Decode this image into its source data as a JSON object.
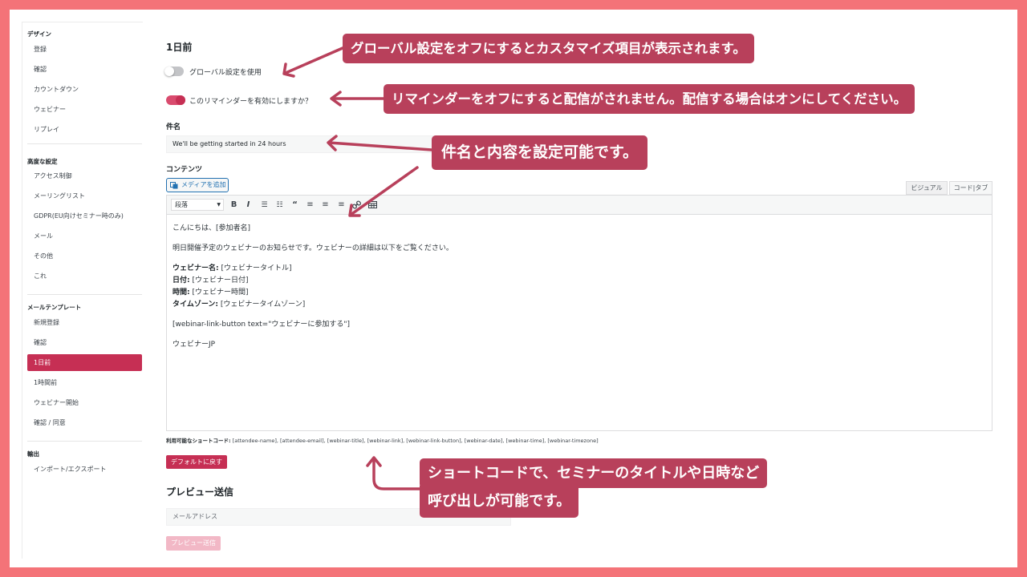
{
  "sidebar": {
    "sections": [
      {
        "heading": "デザイン",
        "items": [
          "登録",
          "確認",
          "カウントダウン",
          "ウェビナー",
          "リプレイ"
        ]
      },
      {
        "heading": "高度な設定",
        "items": [
          "アクセス制御",
          "メーリングリスト",
          "GDPR(EU向けセミナー時のみ)",
          "メール",
          "その他",
          "これ"
        ]
      },
      {
        "heading": "メールテンプレート",
        "items": [
          "新規登録",
          "確認",
          "1日前",
          "1時間前",
          "ウェビナー開始",
          "確認 / 同意"
        ]
      },
      {
        "heading": "輸出",
        "items": [
          "インポート/エクスポート"
        ]
      }
    ],
    "active_item": "1日前"
  },
  "main": {
    "title": "1日前",
    "global_toggle_label": "グローバル設定を使用",
    "global_toggle_on": false,
    "reminder_toggle_label": "このリマインダーを有効にしますか？",
    "reminder_toggle_on": true,
    "subject_label": "件名",
    "subject_value": "We'll be getting started in 24 hours",
    "content_label": "コンテンツ",
    "media_button": "メディアを追加",
    "tabs": [
      "ビジュアル",
      "コード|タブ"
    ],
    "format_select": "段落",
    "toolbar_icons": [
      "bold-icon",
      "italic-icon",
      "bullet-list-icon",
      "numbered-list-icon",
      "blockquote-icon",
      "align-left-icon",
      "align-center-icon",
      "align-right-icon",
      "link-icon",
      "table-icon"
    ],
    "editor": {
      "greeting": "こんにちは、[参加者名]",
      "intro": "明日開催予定のウェビナーのお知らせです。ウェビナーの詳細は以下をご覧ください。",
      "details": [
        {
          "key": "ウェビナー名:",
          "value": " [ウェビナータイトル]"
        },
        {
          "key": "日付:",
          "value": " [ウェビナー日付]"
        },
        {
          "key": "時間:",
          "value": " [ウェビナー時間]"
        },
        {
          "key": "タイムゾーン:",
          "value": " [ウェビナータイムゾーン]"
        }
      ],
      "shortcode": "[webinar-link-button text=\"ウェビナーに参加する\"]",
      "signature": "ウェビナーJP"
    },
    "shortcodes_label": "利用可能なショートコード:",
    "shortcodes_list": " [attendee-name], [attendee-email], [webinar-title], [webinar-link], [webinar-link-button], [webinar-date], [webinar-time], [webinar-timezone]",
    "reset_button": "デフォルトに戻す",
    "preview_title": "プレビュー送信",
    "email_placeholder": "メールアドレス",
    "preview_button": "プレビュー送信"
  },
  "callouts": {
    "c1": "グローバル設定をオフにするとカスタマイズ項目が表示されます。",
    "c2": "リマインダーをオフにすると配信がされません。配信する場合はオンにしてください。",
    "c3": "件名と内容を設定可能です。",
    "c4_line1": "ショートコードで、セミナーのタイトルや日時など",
    "c4_line2": "呼び出しが可能です。"
  },
  "colors": {
    "frame": "#f47378",
    "accent": "#c62f54",
    "callout": "#b8405b"
  }
}
